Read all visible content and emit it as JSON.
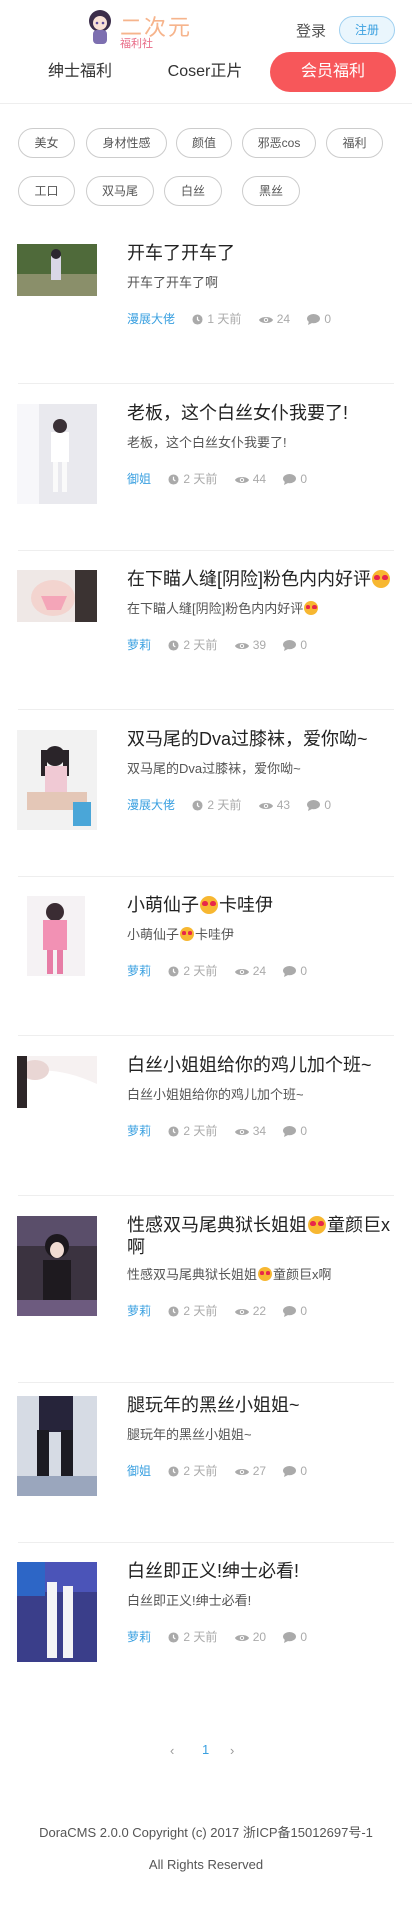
{
  "header": {
    "logo_main": "二次元",
    "logo_sub": "福利社",
    "login_label": "登录",
    "register_label": "注册"
  },
  "tabs": [
    {
      "label": "绅士福利",
      "active": false
    },
    {
      "label": "Coser正片",
      "active": false
    },
    {
      "label": "会员福利",
      "active": true
    }
  ],
  "tags": [
    "美女",
    "身材性感",
    "颜值",
    "邪恶cos",
    "福利",
    "工口",
    "双马尾",
    "白丝",
    "黑丝"
  ],
  "posts": [
    {
      "title": "开车了开车了",
      "excerpt": "开车了开车了啊",
      "author": "漫展大佬",
      "time": "1 天前",
      "views": "24",
      "comments": "0"
    },
    {
      "title": "老板，这个白丝女仆我要了!",
      "excerpt": "老板，这个白丝女仆我要了!",
      "author": "御姐",
      "time": "2 天前",
      "views": "44",
      "comments": "0"
    },
    {
      "title": "在下瞄人缝[阴险]粉色内内好评",
      "excerpt": "在下瞄人缝[阴险]粉色内内好评",
      "author": "萝莉",
      "time": "2 天前",
      "views": "39",
      "comments": "0"
    },
    {
      "title": "双马尾的Dva过膝袜，爱你呦~",
      "excerpt": "双马尾的Dva过膝袜，爱你呦~",
      "author": "漫展大佬",
      "time": "2 天前",
      "views": "43",
      "comments": "0"
    },
    {
      "title_before": "小萌仙子",
      "title_after": "卡哇伊",
      "excerpt_before": "小萌仙子",
      "excerpt_after": "卡哇伊",
      "author": "萝莉",
      "time": "2 天前",
      "views": "24",
      "comments": "0"
    },
    {
      "title": "白丝小姐姐给你的鸡儿加个班~",
      "excerpt": "白丝小姐姐给你的鸡儿加个班~",
      "author": "萝莉",
      "time": "2 天前",
      "views": "34",
      "comments": "0"
    },
    {
      "title_before": "性感双马尾典狱长姐姐",
      "title_after": "童颜巨x啊",
      "excerpt_before": "性感双马尾典狱长姐姐",
      "excerpt_after": "童颜巨x啊",
      "author": "萝莉",
      "time": "2 天前",
      "views": "22",
      "comments": "0"
    },
    {
      "title": "腿玩年的黑丝小姐姐~",
      "excerpt": "腿玩年的黑丝小姐姐~",
      "author": "御姐",
      "time": "2 天前",
      "views": "27",
      "comments": "0"
    },
    {
      "title": "白丝即正义!绅士必看!",
      "excerpt": "白丝即正义!绅士必看!",
      "author": "萝莉",
      "time": "2 天前",
      "views": "20",
      "comments": "0"
    }
  ],
  "pagination": {
    "prev": "‹",
    "current": "1",
    "next": "›"
  },
  "footer": {
    "line1": "DoraCMS 2.0.0  Copyright (c) 2017   浙ICP备15012697号-1",
    "line2": "All Rights Reserved"
  },
  "colors": {
    "accent": "#f7575a",
    "link": "#3aa0e0",
    "meta": "#aaaaaa"
  },
  "icons": [
    "clock-icon",
    "eye-icon",
    "comment-icon",
    "heart-eyes-emoji"
  ]
}
